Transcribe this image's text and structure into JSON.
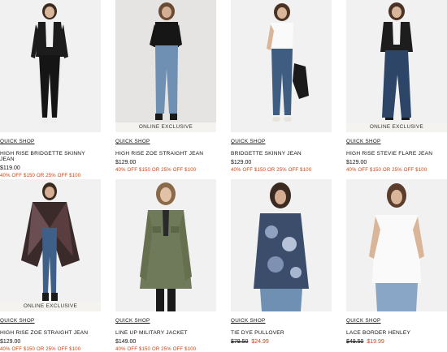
{
  "products": [
    {
      "quick_shop": "QUICK SHOP",
      "name": "HIGH RISE BRIDGETTE SKINNY JEAN",
      "price": "$119.00",
      "promo": "40% OFF $150 OR 25% OFF $100"
    },
    {
      "quick_shop": "QUICK SHOP",
      "badge": "ONLINE EXCLUSIVE",
      "name": "HIGH RISE ZOE STRAIGHT JEAN",
      "price": "$129.00",
      "promo": "40% OFF $150 OR 25% OFF $100"
    },
    {
      "quick_shop": "QUICK SHOP",
      "name": "BRIDGETTE SKINNY JEAN",
      "price": "$129.00",
      "promo": "40% OFF $150 OR 25% OFF $100"
    },
    {
      "quick_shop": "QUICK SHOP",
      "badge": "ONLINE EXCLUSIVE",
      "name": "HIGH RISE STEVIE FLARE JEAN",
      "price": "$129.00",
      "promo": "40% OFF $150 OR 25% OFF $100"
    },
    {
      "quick_shop": "QUICK SHOP",
      "badge": "ONLINE EXCLUSIVE",
      "name": "HIGH RISE ZOE STRAIGHT JEAN",
      "price": "$129.00",
      "promo": "40% OFF $150 OR 25% OFF $100"
    },
    {
      "quick_shop": "QUICK SHOP",
      "name": "LINE UP MILITARY JACKET",
      "price": "$149.00",
      "promo": "40% OFF $150 OR 25% OFF $100"
    },
    {
      "quick_shop": "QUICK SHOP",
      "name": "TIE DYE PULLOVER",
      "was_price": "$79.50",
      "sale_price": "$24.99"
    },
    {
      "quick_shop": "QUICK SHOP",
      "name": "LACE BORDER HENLEY",
      "was_price": "$49.50",
      "sale_price": "$19.99"
    }
  ],
  "colors": {
    "promo": "#c0461a",
    "badge_bg": "#f5f3f0",
    "image_bg": "#f1f1f1"
  }
}
